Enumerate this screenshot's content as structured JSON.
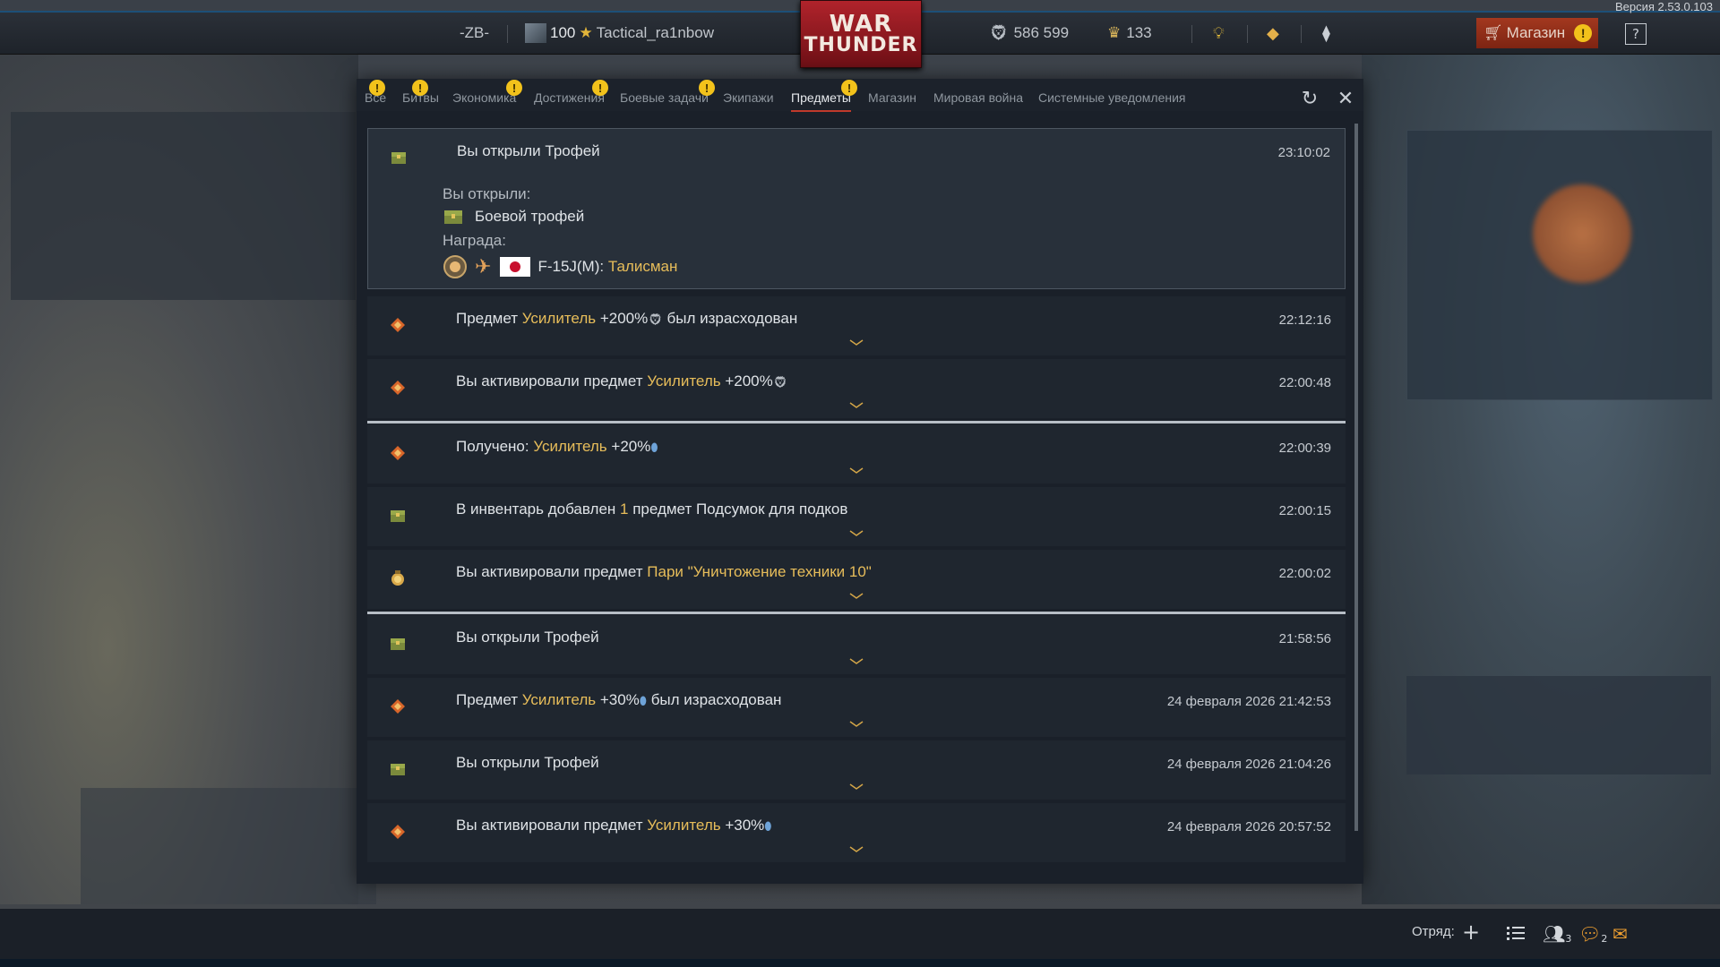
{
  "version": "Версия 2.53.0.103",
  "topbar": {
    "squad_tag": "-ZB-",
    "level": "100",
    "nickname": "Tactical_ra1nbow",
    "logo_line1": "WAR",
    "logo_line2": "THUNDER",
    "silver_lions": "586 599",
    "golden_eagles": "133",
    "shop_label": "Магазин",
    "help_label": "?"
  },
  "tabs": [
    {
      "label": "Все",
      "badge": "!"
    },
    {
      "label": "Битвы",
      "badge": "!"
    },
    {
      "label": "Экономика",
      "badge": "!"
    },
    {
      "label": "Достижения",
      "badge": "!"
    },
    {
      "label": "Боевые задачи",
      "badge": "!"
    },
    {
      "label": "Экипажи",
      "badge": ""
    },
    {
      "label": "Предметы",
      "badge": "!",
      "active": true
    },
    {
      "label": "Магазин",
      "badge": ""
    },
    {
      "label": "Мировая война",
      "badge": ""
    },
    {
      "label": "Системные уведомления",
      "badge": ""
    }
  ],
  "expanded": {
    "title": "Вы открыли Трофей",
    "time": "23:10:02",
    "opened_label": "Вы открыли:",
    "opened_item": "Боевой трофей",
    "reward_label": "Награда:",
    "reward_vehicle": "F-15J(M):",
    "reward_item": "Талисман"
  },
  "rows": [
    {
      "pre": "Предмет ",
      "hl": "Усилитель",
      "post": " +200%",
      "suffix": " был израсходован",
      "time": "22:12:16",
      "icon": "booster"
    },
    {
      "pre": "Вы активировали предмет ",
      "hl": "Усилитель",
      "post": " +200%",
      "suffix": "",
      "time": "22:00:48",
      "icon": "booster"
    },
    {
      "pre": "Получено: ",
      "hl": "Усилитель",
      "post": " +20%",
      "suffix": "",
      "time": "22:00:39",
      "icon": "booster"
    },
    {
      "pre": "В инвентарь добавлен ",
      "hl": "1",
      "post": " предмет Подсумок для подков",
      "suffix": "",
      "time": "22:00:15",
      "icon": "chest"
    },
    {
      "pre": "Вы активировали предмет ",
      "hl": "Пари \"Уничтожение техники 10\"",
      "post": "",
      "suffix": "",
      "time": "22:00:02",
      "icon": "wager"
    },
    {
      "pre": "Вы открыли Трофей",
      "hl": "",
      "post": "",
      "suffix": "",
      "time": "21:58:56",
      "icon": "chest"
    },
    {
      "pre": "Предмет ",
      "hl": "Усилитель",
      "post": " +30%",
      "suffix": " был израсходован",
      "time": "24 февраля 2026 21:42:53",
      "icon": "booster"
    },
    {
      "pre": "Вы открыли Трофей",
      "hl": "",
      "post": "",
      "suffix": "",
      "time": "24 февраля 2026 21:04:26",
      "icon": "chest"
    },
    {
      "pre": "Вы активировали предмет ",
      "hl": "Усилитель",
      "post": " +30%",
      "suffix": "",
      "time": "24 февраля 2026 20:57:52",
      "icon": "booster"
    }
  ],
  "bottombar": {
    "squad_label": "Отряд:",
    "contacts_count": "3",
    "chat_count": "2"
  },
  "colors": {
    "accent_red": "#c0392b",
    "highlight_gold": "#e7bd5a",
    "warning_yellow": "#f2c21b"
  }
}
